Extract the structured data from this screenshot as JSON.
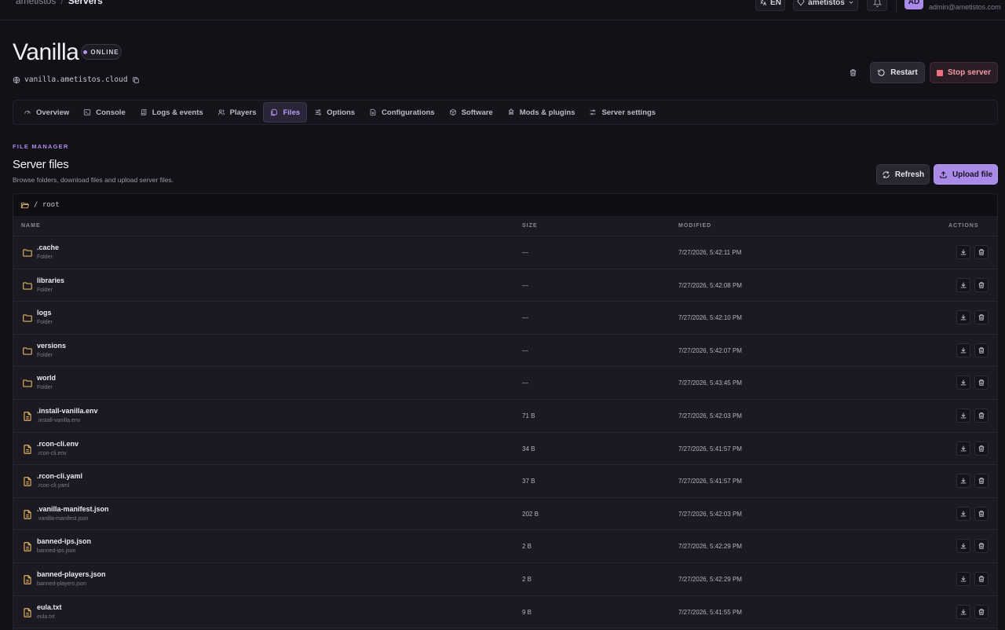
{
  "topbar": {
    "breadcrumb_parent": "ametistos",
    "breadcrumb_sep": "/",
    "breadcrumb_current": "Servers",
    "language": "EN",
    "org": "ametistos",
    "avatar_initials": "AD",
    "user_email": "admin@ametistos.com"
  },
  "server": {
    "name": "Vanilla",
    "status": "ONLINE",
    "domain": "vanilla.ametistos.cloud",
    "restart_label": "Restart",
    "stop_label": "Stop server"
  },
  "tabs": [
    {
      "label": "Overview",
      "icon": "gauge-icon"
    },
    {
      "label": "Console",
      "icon": "terminal-icon"
    },
    {
      "label": "Logs & events",
      "icon": "scroll-icon"
    },
    {
      "label": "Players",
      "icon": "users-icon"
    },
    {
      "label": "Files",
      "icon": "files-icon",
      "active": true
    },
    {
      "label": "Options",
      "icon": "sliders-icon"
    },
    {
      "label": "Configurations",
      "icon": "file-cog-icon"
    },
    {
      "label": "Software",
      "icon": "package-icon"
    },
    {
      "label": "Mods & plugins",
      "icon": "puzzle-icon"
    },
    {
      "label": "Server settings",
      "icon": "settings-sliders-icon"
    }
  ],
  "file_manager": {
    "eyebrow": "FILE MANAGER",
    "title": "Server files",
    "description": "Browse folders, download files and upload server files.",
    "refresh_label": "Refresh",
    "upload_label": "Upload file",
    "path": "/ root"
  },
  "table": {
    "headers": {
      "name": "NAME",
      "size": "SIZE",
      "modified": "MODIFIED",
      "actions": "ACTIONS"
    },
    "rows": [
      {
        "name": ".cache",
        "sub": "Folder",
        "type": "folder",
        "size": "—",
        "modified": "7/27/2026, 5:42:11 PM"
      },
      {
        "name": "libraries",
        "sub": "Folder",
        "type": "folder",
        "size": "—",
        "modified": "7/27/2026, 5:42:08 PM"
      },
      {
        "name": "logs",
        "sub": "Folder",
        "type": "folder",
        "size": "—",
        "modified": "7/27/2026, 5:42:10 PM"
      },
      {
        "name": "versions",
        "sub": "Folder",
        "type": "folder",
        "size": "—",
        "modified": "7/27/2026, 5:42:07 PM"
      },
      {
        "name": "world",
        "sub": "Folder",
        "type": "folder",
        "size": "—",
        "modified": "7/27/2026, 5:43:45 PM"
      },
      {
        "name": ".install-vanilla.env",
        "sub": ".install-vanilla.env",
        "type": "file",
        "size": "71 B",
        "modified": "7/27/2026, 5:42:03 PM"
      },
      {
        "name": ".rcon-cli.env",
        "sub": ".rcon-cli.env",
        "type": "file",
        "size": "34 B",
        "modified": "7/27/2026, 5:41:57 PM"
      },
      {
        "name": ".rcon-cli.yaml",
        "sub": ".rcon-cli.yaml",
        "type": "file",
        "size": "37 B",
        "modified": "7/27/2026, 5:41:57 PM"
      },
      {
        "name": ".vanilla-manifest.json",
        "sub": ".vanilla-manifest.json",
        "type": "file",
        "size": "202 B",
        "modified": "7/27/2026, 5:42:03 PM"
      },
      {
        "name": "banned-ips.json",
        "sub": "banned-ips.json",
        "type": "file",
        "size": "2 B",
        "modified": "7/27/2026, 5:42:29 PM"
      },
      {
        "name": "banned-players.json",
        "sub": "banned-players.json",
        "type": "file",
        "size": "2 B",
        "modified": "7/27/2026, 5:42:29 PM"
      },
      {
        "name": "eula.txt",
        "sub": "eula.txt",
        "type": "file",
        "size": "9 B",
        "modified": "7/27/2026, 5:41:55 PM"
      }
    ]
  },
  "colors": {
    "accent": "#a98ae8",
    "folder_icon": "#e0b25c",
    "danger": "#f0707f",
    "background": "#131118"
  }
}
